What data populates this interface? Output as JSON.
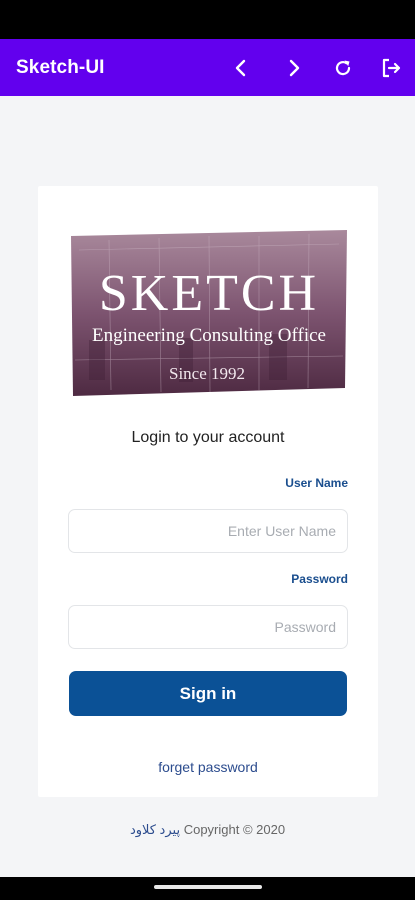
{
  "app": {
    "title": "Sketch-UI",
    "accent": "#6200ee",
    "icons": [
      "chevron-left-icon",
      "chevron-right-icon",
      "refresh-icon",
      "logout-icon"
    ]
  },
  "logo": {
    "main": "SKETCH",
    "subtitle": "Engineering Consulting Office",
    "since": "Since 1992"
  },
  "login": {
    "title": "Login to your account",
    "username_label": "User Name",
    "username_placeholder": "Enter User Name",
    "password_label": "Password",
    "password_placeholder": "Password",
    "signin_label": "Sign in",
    "signin_color": "#0b5196",
    "forget_label": "forget password"
  },
  "footer": {
    "brand": "پیرد کلاود",
    "copyright": "Copyright © 2020"
  }
}
